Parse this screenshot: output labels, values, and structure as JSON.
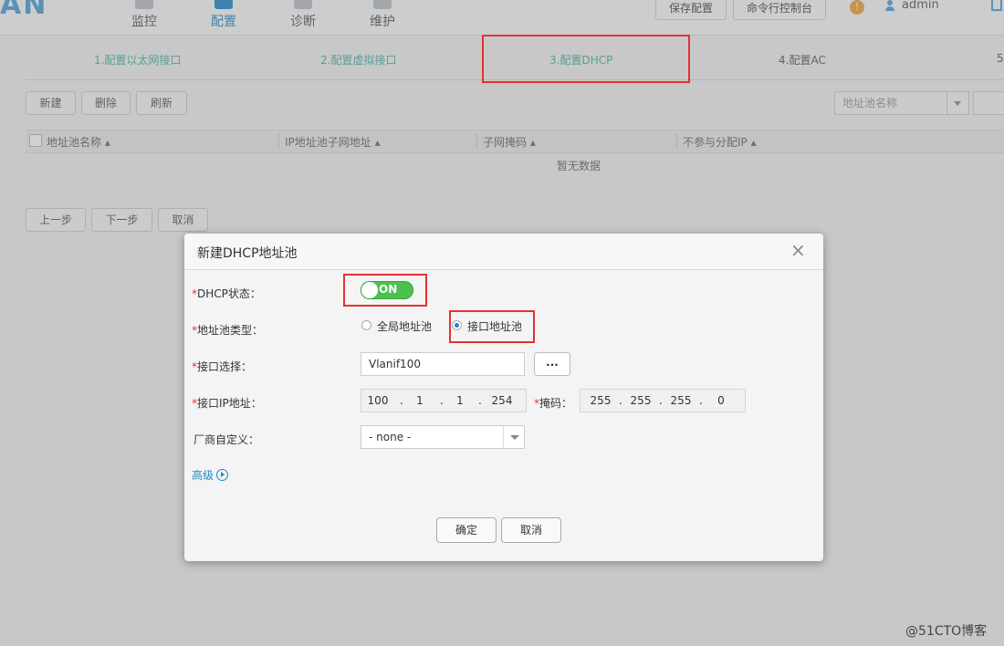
{
  "nav": {
    "logo": "AN",
    "items": [
      {
        "label": "监控"
      },
      {
        "label": "配置"
      },
      {
        "label": "诊断"
      },
      {
        "label": "维护"
      }
    ],
    "save_config": "保存配置",
    "cli_console": "命令行控制台",
    "user": "admin"
  },
  "steps": [
    {
      "label": "1.配置以太网接口"
    },
    {
      "label": "2.配置虚拟接口"
    },
    {
      "label": "3.配置DHCP"
    },
    {
      "label": "4.配置AC"
    },
    {
      "label": "5"
    }
  ],
  "toolbar": {
    "new": "新建",
    "delete": "删除",
    "refresh": "刷新",
    "search_placeholder": "地址池名称"
  },
  "table": {
    "columns": [
      "地址池名称",
      "IP地址池子网地址",
      "子网掩码",
      "不参与分配IP"
    ],
    "empty": "暂无数据"
  },
  "wizard_buttons": {
    "prev": "上一步",
    "next": "下一步",
    "cancel": "取消"
  },
  "dialog": {
    "title": "新建DHCP地址池",
    "close": "×",
    "dhcp_status_label": "DHCP状态：",
    "toggle_text": "ON",
    "pool_type_label": "地址池类型：",
    "pool_type_options": [
      "全局地址池",
      "接口地址池"
    ],
    "pool_type_selected": "接口地址池",
    "interface_label": "接口选择：",
    "interface_value": "Vlanif100",
    "browse_label": "...",
    "ip_label": "接口IP地址：",
    "ip": [
      "100",
      "1",
      "1",
      "254"
    ],
    "mask_label": "掩码：",
    "mask": [
      "255",
      "255",
      "255",
      "0"
    ],
    "vendor_label": "厂商自定义：",
    "vendor_value": "- none -",
    "advanced": "高级",
    "ok": "确定",
    "cancel": "取消"
  },
  "watermark": "@51CTO博客",
  "colors": {
    "accent": "#1e88c8",
    "step": "#3fb6a5",
    "toggle_on": "#4cc04c",
    "highlight": "#e53030"
  }
}
